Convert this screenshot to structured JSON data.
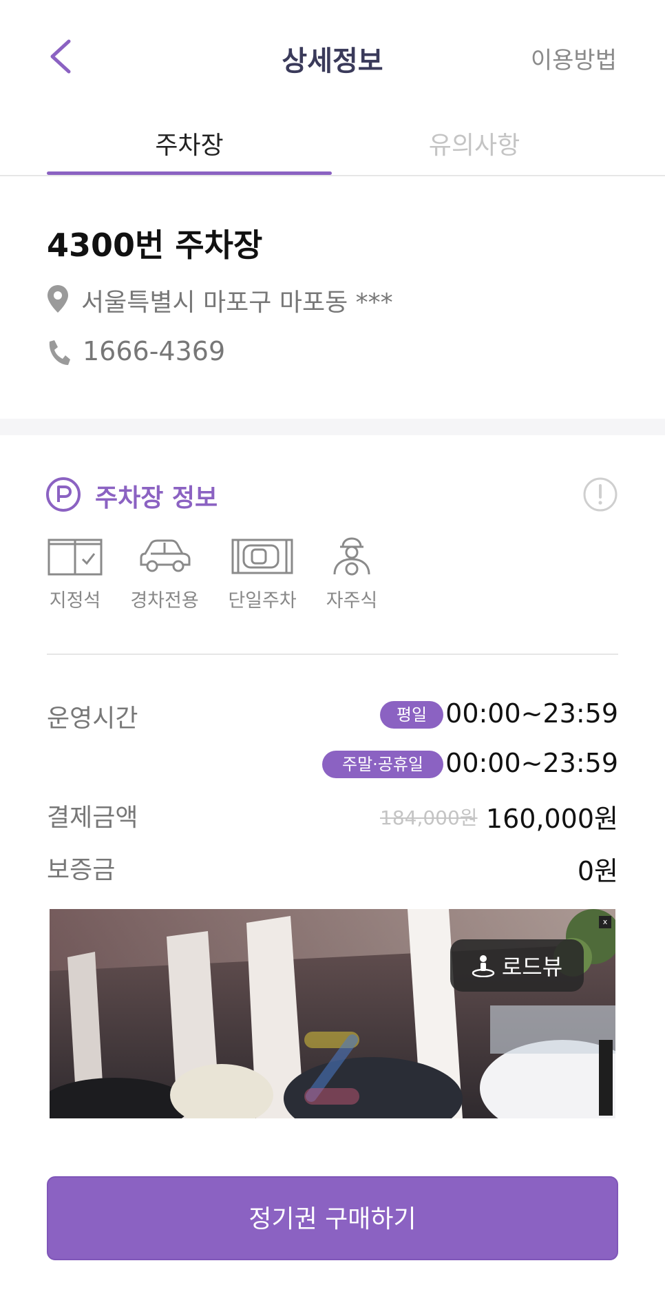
{
  "header": {
    "title": "상세정보",
    "help_label": "이용방법"
  },
  "tabs": [
    {
      "label": "주차장",
      "active": true
    },
    {
      "label": "유의사항",
      "active": false
    }
  ],
  "lot": {
    "name": "4300번 주차장",
    "address": "서울특별시 마포구 마포동 ***",
    "phone": "1666-4369"
  },
  "info": {
    "title": "주차장 정보",
    "features": [
      {
        "icon": "reserved-seat-icon",
        "label": "지정석"
      },
      {
        "icon": "compact-car-icon",
        "label": "경차전용"
      },
      {
        "icon": "single-parking-icon",
        "label": "단일주차"
      },
      {
        "icon": "self-parking-icon",
        "label": "자주식"
      }
    ],
    "hours_label": "운영시간",
    "hours": [
      {
        "badge": "평일",
        "time": "00:00~23:59"
      },
      {
        "badge": "주말·공휴일",
        "time": "00:00~23:59"
      }
    ],
    "payment_label": "결제금액",
    "original_price": "184,000원",
    "price": "160,000원",
    "deposit_label": "보증금",
    "deposit": "0원"
  },
  "roadview": {
    "badge_label": "로드뷰",
    "close_label": "x"
  },
  "cta": {
    "label": "정기권 구매하기"
  },
  "colors": {
    "accent": "#8b62c2",
    "muted": "#777777",
    "divider": "#e6e6e6"
  }
}
